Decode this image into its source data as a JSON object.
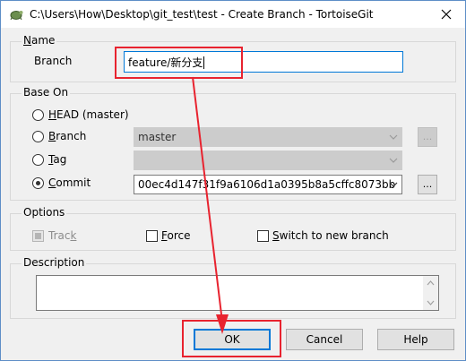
{
  "window": {
    "title": "C:\\Users\\How\\Desktop\\git_test\\test - Create Branch - TortoiseGit"
  },
  "name_group": {
    "label": "Name",
    "branch_label": "Branch",
    "branch_value": "feature/新分支"
  },
  "base_on_group": {
    "label": "Base On",
    "head_option": {
      "accel": "H",
      "rest": "EAD (master)",
      "selected": false
    },
    "branch_option": {
      "accel": "B",
      "rest": "ranch",
      "selected": false,
      "value": "master"
    },
    "tag_option": {
      "accel": "T",
      "rest": "ag",
      "selected": false,
      "value": ""
    },
    "commit_option": {
      "accel": "C",
      "rest": "ommit",
      "selected": true,
      "value": "00ec4d147f31f9a6106d1a0395b8a5cffc8073bb"
    },
    "ellipsis_label": "..."
  },
  "options_group": {
    "label": "Options",
    "track": {
      "pre": "Trac",
      "accel": "k",
      "post": "",
      "checked": true,
      "enabled": false
    },
    "force": {
      "pre": "",
      "accel": "F",
      "post": "orce",
      "checked": false
    },
    "switch": {
      "pre": "",
      "accel": "S",
      "post": "witch to new branch",
      "checked": false
    }
  },
  "description_group": {
    "label": "Description",
    "value": ""
  },
  "buttons": {
    "ok": "OK",
    "cancel": "Cancel",
    "help": "Help"
  },
  "annotation": {
    "color": "#e8232f"
  },
  "icons": {
    "app": "tortoisegit-icon",
    "close": "close-icon",
    "dropdown": "chevron-down-icon"
  }
}
